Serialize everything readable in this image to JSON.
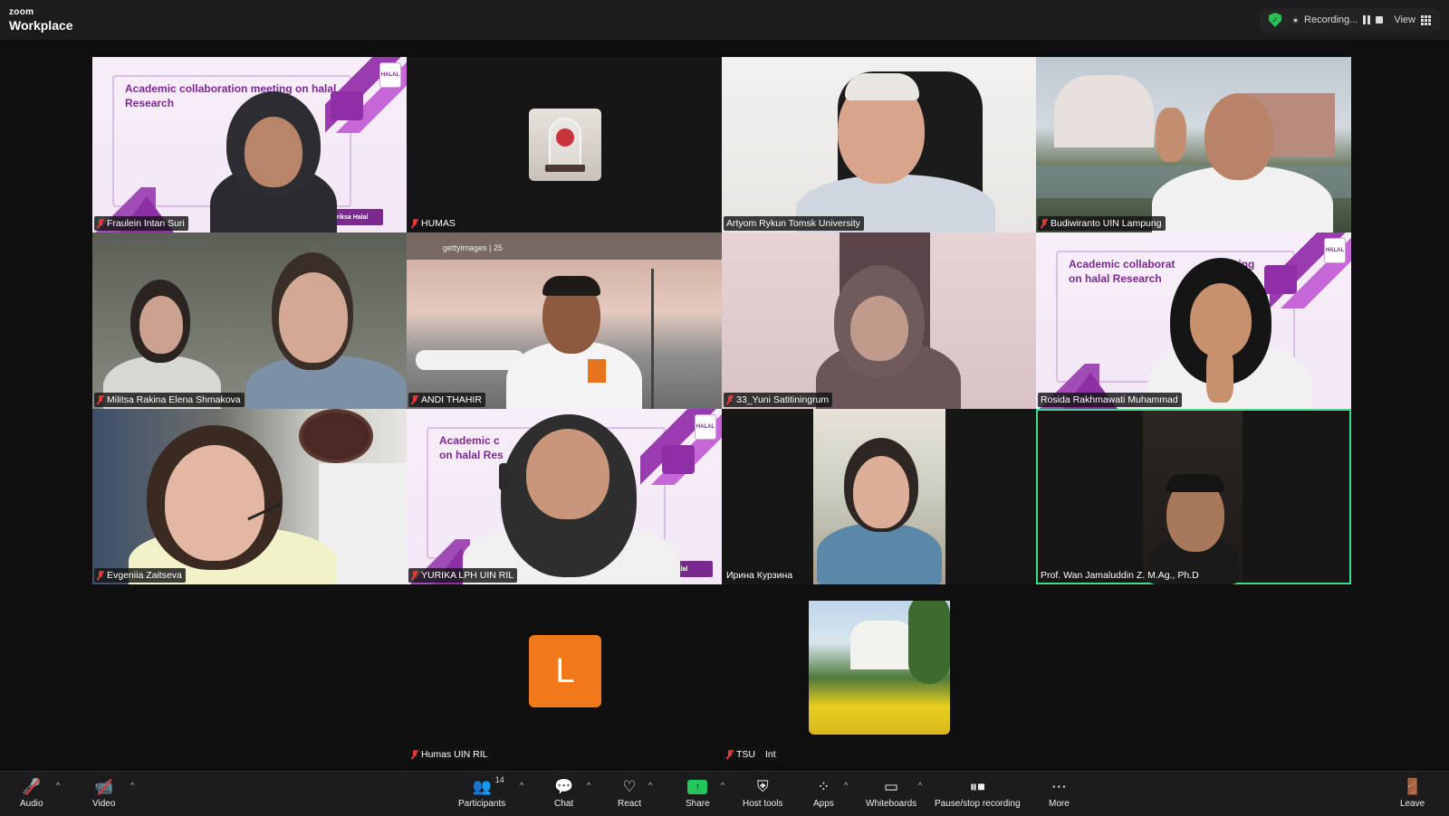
{
  "app": {
    "brand_small": "zoom",
    "brand_main": "Workplace"
  },
  "topbar": {
    "recording_label": "Recording...",
    "view_label": "View"
  },
  "slide_text": {
    "title": "Academic collaboration meeting on halal Research",
    "title_cut": "Academic collaborat",
    "title_cut2": "ing",
    "title_cut_b": "Academic c",
    "title_cut_b2": "eting",
    "sub_cut_b": "on halal Res",
    "logo": "HALAL",
    "band": "Halal",
    "band_left": "eriksa Halal"
  },
  "watermark": {
    "text": "gettyimages | 25"
  },
  "participants": [
    {
      "name": "Fraulein Intan Suri",
      "muted": true
    },
    {
      "name": "HUMAS",
      "muted": true
    },
    {
      "name": "Artyom Rykun Tomsk University",
      "muted": false
    },
    {
      "name": "Budiwiranto UIN Lampung",
      "muted": true
    },
    {
      "name": "Militsa Rakina Elena Shmakova",
      "muted": true
    },
    {
      "name": "ANDI THAHIR",
      "muted": true
    },
    {
      "name": "33_Yuni Satitiningrum",
      "muted": true
    },
    {
      "name": "Rosida Rakhmawati Muhammad",
      "muted": false
    },
    {
      "name": "Evgeniia Zaitseva",
      "muted": true
    },
    {
      "name": "YURIKA LPH UIN RIL",
      "muted": true
    },
    {
      "name": "Ирина Курзина",
      "muted": false
    },
    {
      "name": "Prof. Wan Jamaluddin Z. M.Ag., Ph.D",
      "muted": false,
      "active_speaker": true
    },
    {
      "name": "Humas UIN RIL",
      "muted": true,
      "avatar_letter": "L"
    },
    {
      "name": "TSU",
      "extra": "Int",
      "muted": true
    }
  ],
  "toolbar": {
    "audio": "Audio",
    "video": "Video",
    "participants": "Participants",
    "participants_count": "14",
    "chat": "Chat",
    "react": "React",
    "share": "Share",
    "host_tools": "Host tools",
    "apps": "Apps",
    "whiteboards": "Whiteboards",
    "pause_stop": "Pause/stop recording",
    "more": "More",
    "leave": "Leave"
  },
  "colors": {
    "accent_green": "#24c65b",
    "active_border": "#3fdc8a",
    "muted_red": "#e23a3a",
    "avatar_orange": "#f07a1a",
    "slide_purple": "#7b2a8e"
  }
}
